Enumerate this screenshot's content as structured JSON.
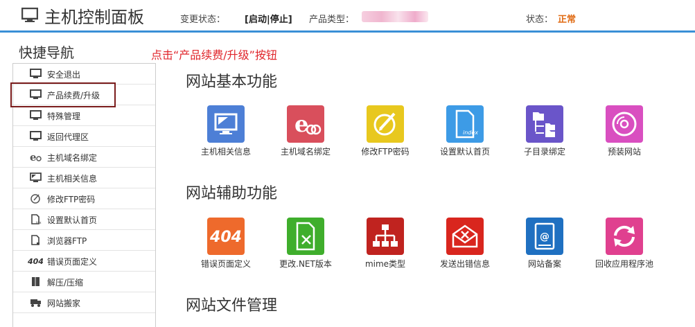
{
  "header": {
    "title": "主机控制面板",
    "change_status_label": "变更状态：",
    "change_controls": "[启动|停止]",
    "product_type_label": "产品类型：",
    "status_label": "状态：",
    "status_value": "正常"
  },
  "sidebar": {
    "title": "快捷导航",
    "items": [
      {
        "label": "安全退出",
        "icon": "monitor-icon"
      },
      {
        "label": "产品续费/升级",
        "icon": "monitor-icon"
      },
      {
        "label": "特殊管理",
        "icon": "monitor-icon"
      },
      {
        "label": "返回代理区",
        "icon": "monitor-icon"
      },
      {
        "label": "主机域名绑定",
        "icon": "domain-binding-icon"
      },
      {
        "label": "主机相关信息",
        "icon": "host-info-icon"
      },
      {
        "label": "修改FTP密码",
        "icon": "edit-icon"
      },
      {
        "label": "设置默认首页",
        "icon": "document-icon"
      },
      {
        "label": "浏览器FTP",
        "icon": "document-icon"
      },
      {
        "label": "错误页面定义",
        "icon": "error-404-icon"
      },
      {
        "label": "解压/压缩",
        "icon": "archive-icon"
      },
      {
        "label": "网站搬家",
        "icon": "truck-icon"
      }
    ]
  },
  "annotation": {
    "text": "点击“产品续费/升级”按钮"
  },
  "sections": {
    "basic": {
      "title": "网站基本功能",
      "tiles": [
        {
          "label": "主机相关信息",
          "color": "#4d7fd6",
          "icon": "host-info-icon"
        },
        {
          "label": "主机域名绑定",
          "color": "#d94f5c",
          "icon": "domain-binding-icon"
        },
        {
          "label": "修改FTP密码",
          "color": "#e8c81e",
          "icon": "edit-icon"
        },
        {
          "label": "设置默认首页",
          "color": "#3d9be6",
          "icon": "index-page-icon"
        },
        {
          "label": "子目录绑定",
          "color": "#6a55c9",
          "icon": "subfolder-icon"
        },
        {
          "label": "预装网站",
          "color": "#d94fc0",
          "icon": "disc-icon"
        }
      ]
    },
    "aux": {
      "title": "网站辅助功能",
      "tiles": [
        {
          "label": "错误页面定义",
          "color": "#ee6a2c",
          "icon": "error-404-icon",
          "glyph": "404"
        },
        {
          "label": "更改.NET版本",
          "color": "#3fae2c",
          "icon": "net-version-icon"
        },
        {
          "label": "mime类型",
          "color": "#c0231f",
          "icon": "sitemap-icon"
        },
        {
          "label": "发送出错信息",
          "color": "#d9261e",
          "icon": "mail-icon"
        },
        {
          "label": "网站备案",
          "color": "#1f70c1",
          "icon": "address-book-icon"
        },
        {
          "label": "回收应用程序池",
          "color": "#e0408f",
          "icon": "recycle-icon"
        }
      ]
    },
    "files": {
      "title": "网站文件管理"
    }
  }
}
